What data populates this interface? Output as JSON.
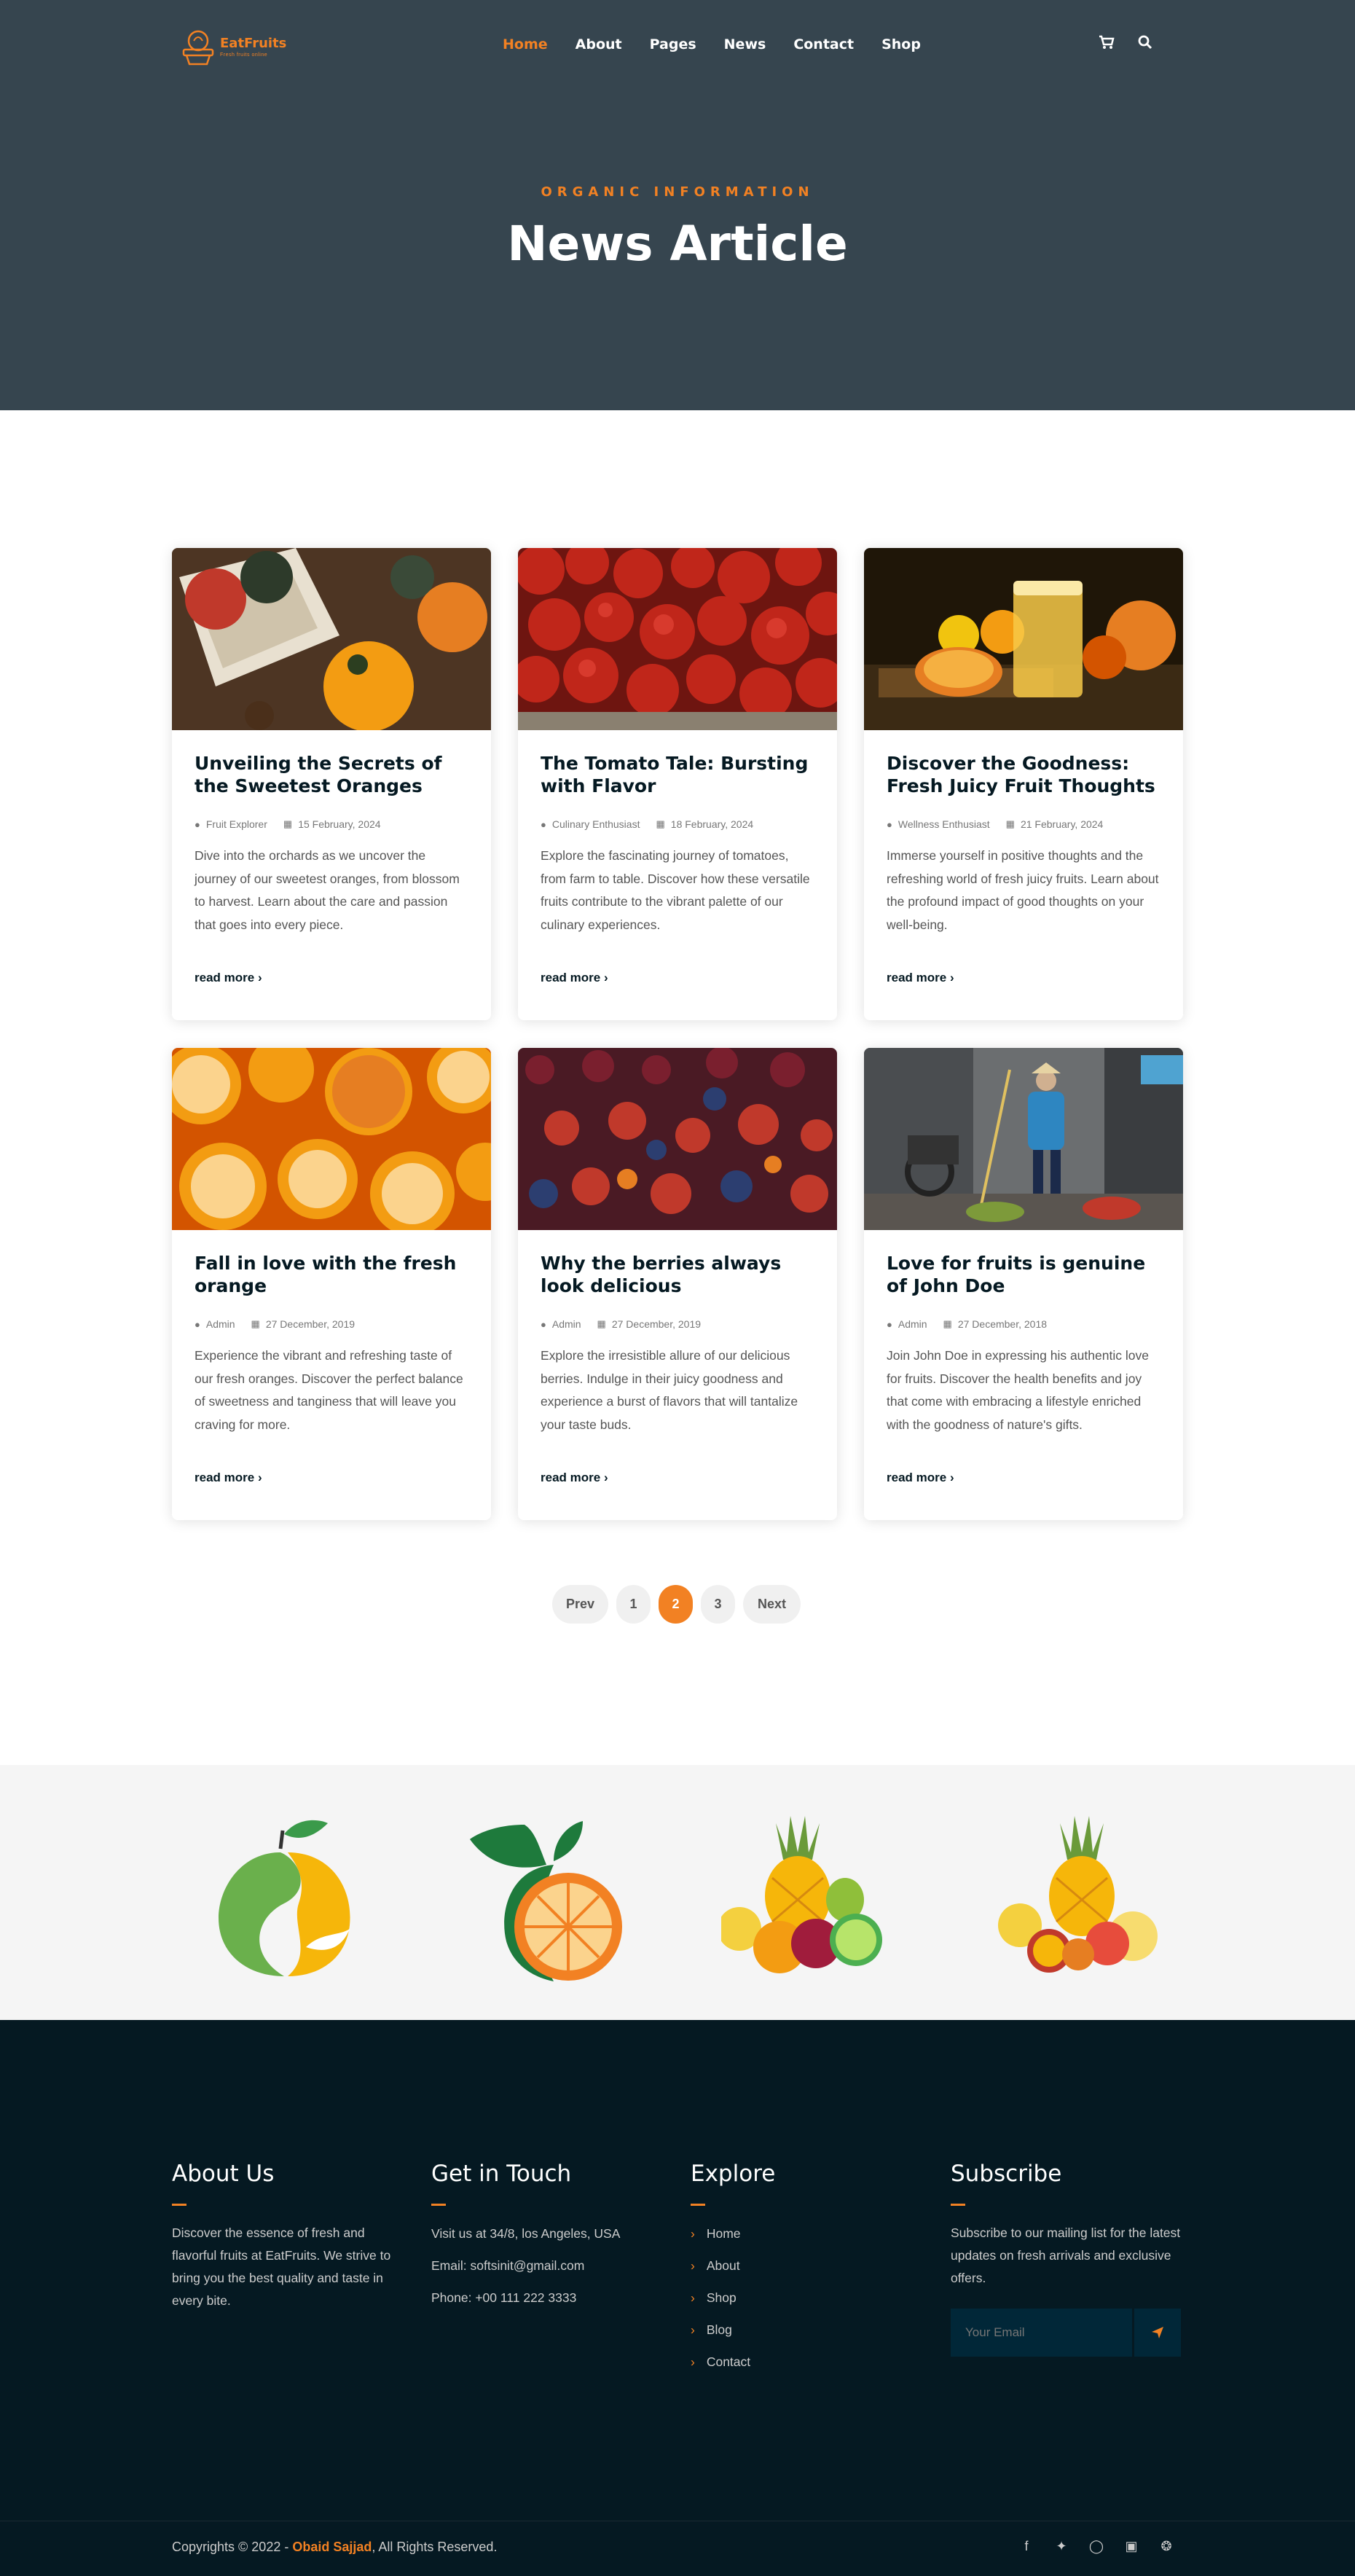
{
  "brand": {
    "name": "EatFruits",
    "tagline": "Fresh fruits online"
  },
  "nav": {
    "items": [
      "Home",
      "About",
      "Pages",
      "News",
      "Contact",
      "Shop"
    ],
    "active": "Home"
  },
  "header_icons": {
    "cart": "cart-icon",
    "search": "search-icon"
  },
  "hero": {
    "subtitle": "ORGANIC INFORMATION",
    "title": "News Article"
  },
  "articles": [
    {
      "title": "Unveiling the Secrets of the Sweetest Oranges",
      "author": "Fruit Explorer",
      "date": "15 February, 2024",
      "excerpt": "Dive into the orchards as we uncover the journey of our sweetest oranges, from blossom to harvest. Learn about the care and passion that goes into every piece.",
      "read_more": "read more",
      "image": "pumpkins-in-crate"
    },
    {
      "title": "The Tomato Tale: Bursting with Flavor",
      "author": "Culinary Enthusiast",
      "date": "18 February, 2024",
      "excerpt": "Explore the fascinating journey of tomatoes, from farm to table. Discover how these versatile fruits contribute to the vibrant palette of our culinary experiences.",
      "read_more": "read more",
      "image": "tomatoes"
    },
    {
      "title": "Discover the Goodness: Fresh Juicy Fruit Thoughts",
      "author": "Wellness Enthusiast",
      "date": "21 February, 2024",
      "excerpt": "Immerse yourself in positive thoughts and the refreshing world of fresh juicy fruits. Learn about the profound impact of good thoughts on your well-being.",
      "read_more": "read more",
      "image": "orange-juice"
    },
    {
      "title": "Fall in love with the fresh orange",
      "author": "Admin",
      "date": "27 December, 2019",
      "excerpt": "Experience the vibrant and refreshing taste of our fresh oranges. Discover the perfect balance of sweetness and tanginess that will leave you craving for more.",
      "read_more": "read more",
      "image": "orange-halves"
    },
    {
      "title": "Why the berries always look delicious",
      "author": "Admin",
      "date": "27 December, 2019",
      "excerpt": "Explore the irresistible allure of our delicious berries. Indulge in their juicy goodness and experience a burst of flavors that will tantalize your taste buds.",
      "read_more": "read more",
      "image": "berries"
    },
    {
      "title": "Love for fruits is genuine of John Doe",
      "author": "Admin",
      "date": "27 December, 2018",
      "excerpt": "Join John Doe in expressing his authentic love for fruits. Discover the health benefits and joy that come with embracing a lifestyle enriched with the goodness of nature's gifts.",
      "read_more": "read more",
      "image": "street-fruit-vendor"
    }
  ],
  "pagination": {
    "prev": "Prev",
    "pages": [
      "1",
      "2",
      "3"
    ],
    "current": "2",
    "next": "Next"
  },
  "footer": {
    "about": {
      "title": "About Us",
      "text": "Discover the essence of fresh and flavorful fruits at EatFruits. We strive to bring you the best quality and taste in every bite."
    },
    "contact": {
      "title": "Get in Touch",
      "address": "Visit us at 34/8, los Angeles, USA",
      "email": "Email: softsinit@gmail.com",
      "phone": "Phone: +00 111 222 3333"
    },
    "explore": {
      "title": "Explore",
      "links": [
        "Home",
        "About",
        "Shop",
        "Blog",
        "Contact"
      ]
    },
    "subscribe": {
      "title": "Subscribe",
      "text": "Subscribe to our mailing list for the latest updates on fresh arrivals and exclusive offers.",
      "placeholder": "Your Email"
    },
    "copyright": {
      "prefix": "Copyrights © 2022 - ",
      "name": "Obaid Sajjad",
      "suffix": ", All Rights Reserved."
    },
    "social": [
      "facebook-icon",
      "twitter-icon",
      "instagram-icon",
      "linkedin-icon",
      "dribbble-icon"
    ]
  },
  "colors": {
    "accent": "#f28123",
    "hero_bg": "#36454f",
    "footer_bg": "#051922",
    "heading": "#051922"
  }
}
